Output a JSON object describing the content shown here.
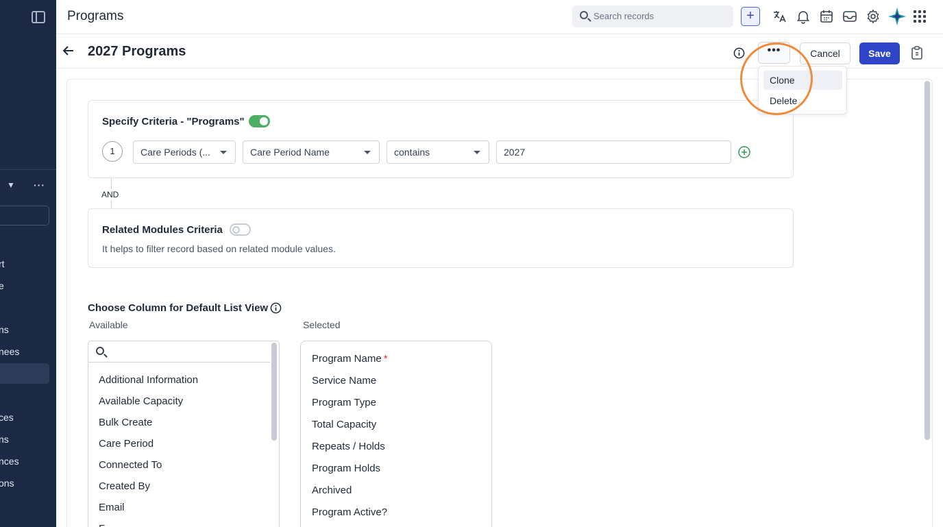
{
  "app": {
    "title": "Programs"
  },
  "search": {
    "placeholder": "Search records"
  },
  "colors": {
    "accent": "#2f45c8",
    "toggle_on": "#4caf65",
    "ring": "#ef8a3a",
    "sidebar_bg": "#1b2945"
  },
  "icons": [
    "panel-toggle-icon",
    "search-icon",
    "plus-icon",
    "translate-icon",
    "bell-icon",
    "calendar-icon",
    "mail-icon",
    "gear-icon",
    "logo-icon",
    "apps-grid-icon",
    "back-arrow-icon",
    "info-icon",
    "more-icon",
    "clipboard-icon",
    "add-circle-icon"
  ],
  "sidebar": {
    "items": [
      "rt",
      "e",
      "ns",
      "nees",
      "ces",
      "ns",
      "nces",
      "ons"
    ]
  },
  "header": {
    "title": "2027 Programs",
    "more_label": "•••",
    "cancel_label": "Cancel",
    "save_label": "Save"
  },
  "menu": {
    "items": [
      "Clone",
      "Delete"
    ]
  },
  "criteria": {
    "title": "Specify Criteria - \"Programs\"",
    "row_number": "1",
    "field1": "Care Periods (...",
    "field2": "Care Period Name",
    "operator": "contains",
    "value": "2027",
    "toggle_on": true
  },
  "connector": "AND",
  "related": {
    "title": "Related Modules Criteria",
    "description": "It helps to filter record based on related module values.",
    "toggle_on": false
  },
  "columns": {
    "title": "Choose Column for Default List View",
    "available_label": "Available",
    "selected_label": "Selected",
    "available": [
      "Additional Information",
      "Available Capacity",
      "Bulk Create",
      "Care Period",
      "Connected To",
      "Created By",
      "Email",
      "F"
    ],
    "selected": [
      "Program Name",
      "Service Name",
      "Program Type",
      "Total Capacity",
      "Repeats / Holds",
      "Program Holds",
      "Archived",
      "Program Active?"
    ],
    "required_mark": "*"
  }
}
